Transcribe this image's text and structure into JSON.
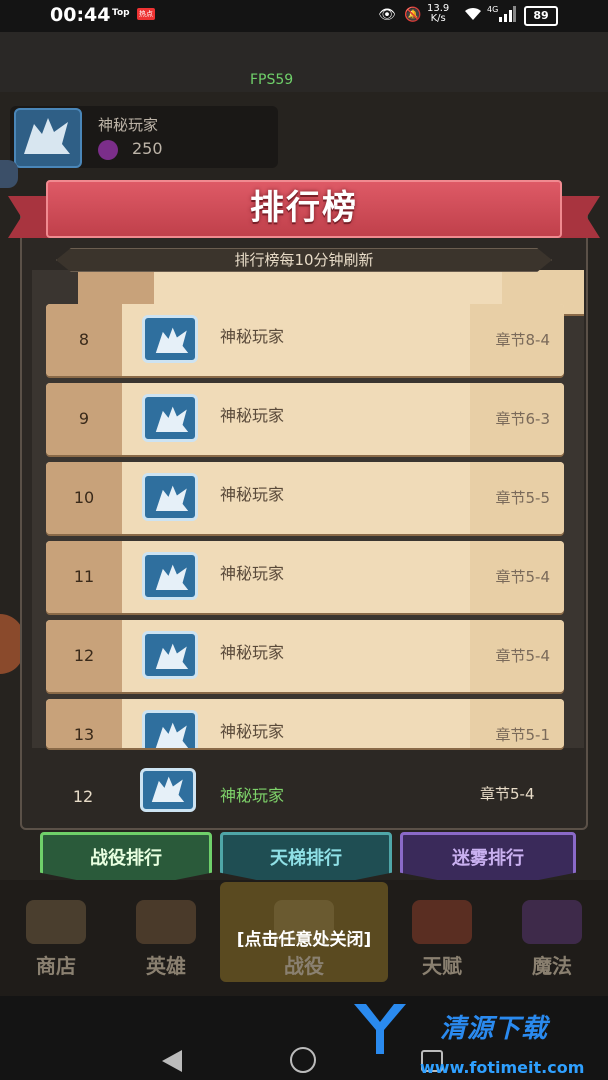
{
  "status_bar": {
    "time": "00:44",
    "tag1": "Top",
    "tag2": "热点",
    "net_speed_value": "13.9",
    "net_speed_unit": "K/s",
    "network": "4G",
    "battery": "89"
  },
  "fps": "FPS59",
  "player_card": {
    "name": "神秘玩家",
    "gold": "250"
  },
  "panel": {
    "title": "排行榜",
    "subtitle": "排行榜每10分钟刷新"
  },
  "rows": [
    {
      "rank": "8",
      "name": "神秘玩家",
      "chapter": "章节8-4"
    },
    {
      "rank": "9",
      "name": "神秘玩家",
      "chapter": "章节6-3"
    },
    {
      "rank": "10",
      "name": "神秘玩家",
      "chapter": "章节5-5"
    },
    {
      "rank": "11",
      "name": "神秘玩家",
      "chapter": "章节5-4"
    },
    {
      "rank": "12",
      "name": "神秘玩家",
      "chapter": "章节5-4"
    },
    {
      "rank": "13",
      "name": "神秘玩家",
      "chapter": "章节5-1"
    }
  ],
  "my_row": {
    "rank": "12",
    "name": "神秘玩家",
    "chapter": "章节5-4"
  },
  "tabs": [
    {
      "label": "战役排行"
    },
    {
      "label": "天梯排行"
    },
    {
      "label": "迷雾排行"
    }
  ],
  "bottom_nav": [
    {
      "label": "商店"
    },
    {
      "label": "英雄"
    },
    {
      "label": "战役"
    },
    {
      "label": "天赋"
    },
    {
      "label": "魔法"
    }
  ],
  "close_hint": "[点击任意处关闭]",
  "watermark": {
    "text": "清源下载",
    "url": "www.fotimeit.com"
  },
  "colors": {
    "ribbon": "#c0404b",
    "row_bg": "#f0dbb8",
    "my_name": "#7ed36a",
    "fps": "#6fd06a"
  }
}
